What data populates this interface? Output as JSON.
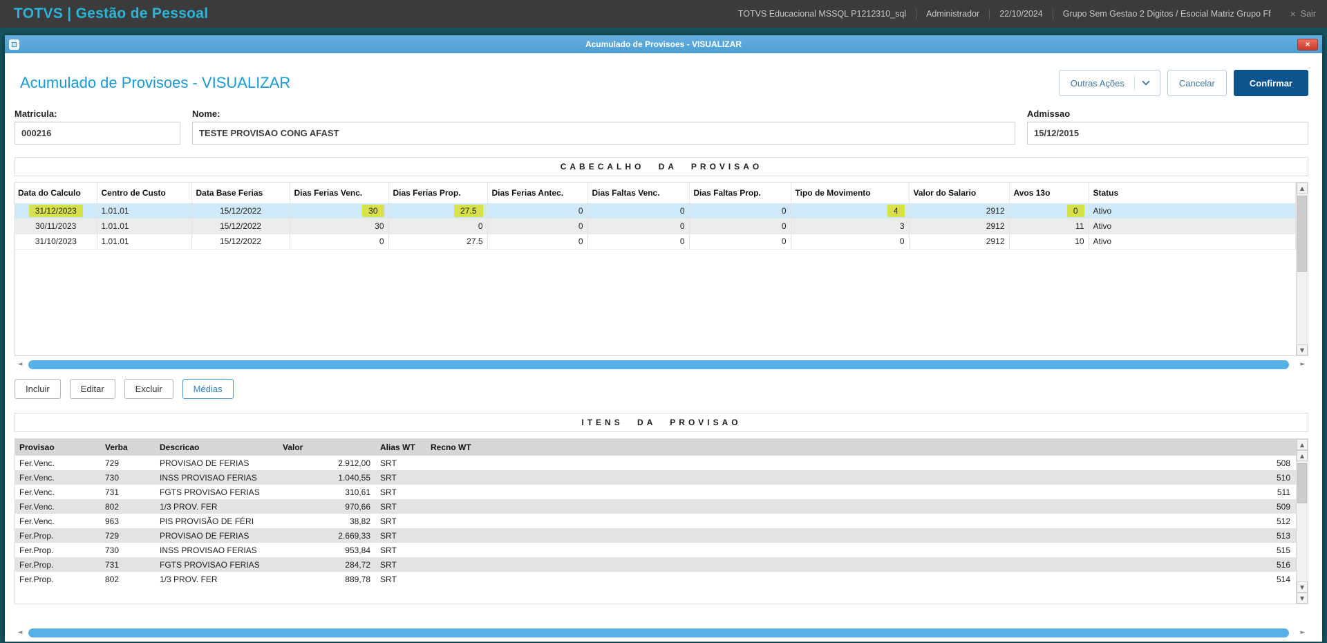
{
  "colors": {
    "brand_cyan": "#2bb5da",
    "titlebar_blue": "#55a6d8",
    "confirm_blue": "#0f538d",
    "selected_row_blue": "#cfe9f8",
    "highlight_yellow": "#d7e14a",
    "close_red": "#d0402f"
  },
  "icons": {
    "up": "▲",
    "down": "▼",
    "left": "◄",
    "right": "►",
    "close": "×",
    "logout_x": "×"
  },
  "topbar": {
    "brand": "TOTVS | Gestão de Pessoal",
    "environment": "TOTVS Educacional MSSQL P1212310_sql",
    "user": "Administrador",
    "date": "22/10/2024",
    "group": "Grupo Sem Gestao 2 Digitos / Esocial Matriz Grupo Ff",
    "logout_label": "Sair"
  },
  "modal": {
    "titlebar_text": "Acumulado de Provisoes - VISUALIZAR",
    "page_title": "Acumulado de Provisoes - VISUALIZAR",
    "actions": {
      "outras_acoes": "Outras Ações",
      "cancelar": "Cancelar",
      "confirmar": "Confirmar"
    }
  },
  "form": {
    "matricula_label": "Matricula:",
    "matricula_value": "000216",
    "nome_label": "Nome:",
    "nome_value": "TESTE PROVISAO CONG AFAST",
    "admissao_label": "Admissao",
    "admissao_value": "15/12/2015"
  },
  "header_section": {
    "title": "CABECALHO DA PROVISAO",
    "columns": [
      "Data do Calculo",
      "Centro de Custo",
      "Data Base Ferias",
      "Dias Ferias Venc.",
      "Dias Ferias Prop.",
      "Dias Ferias Antec.",
      "Dias Faltas Venc.",
      "Dias Faltas Prop.",
      "Tipo de Movimento",
      "Valor do Salario",
      "Avos 13o",
      "Status"
    ],
    "rows": [
      {
        "selected": true,
        "highlighted_cells": [
          0,
          3,
          4,
          8,
          10
        ],
        "cells": [
          "31/12/2023",
          "1.01.01",
          "15/12/2022",
          "30",
          "27.5",
          "0",
          "0",
          "0",
          "4",
          "2912",
          "0",
          "Ativo"
        ]
      },
      {
        "selected": false,
        "highlighted_cells": [],
        "cells": [
          "30/11/2023",
          "1.01.01",
          "15/12/2022",
          "30",
          "0",
          "0",
          "0",
          "0",
          "3",
          "2912",
          "11",
          "Ativo"
        ]
      },
      {
        "selected": false,
        "highlighted_cells": [],
        "cells": [
          "31/10/2023",
          "1.01.01",
          "15/12/2022",
          "0",
          "27.5",
          "0",
          "0",
          "0",
          "0",
          "2912",
          "10",
          "Ativo"
        ]
      }
    ]
  },
  "grid_buttons": [
    "Incluir",
    "Editar",
    "Excluir",
    "Médias"
  ],
  "items_section": {
    "title": "ITENS DA PROVISAO",
    "columns": [
      "Provisao",
      "Verba",
      "Descricao",
      "Valor",
      "Alias WT",
      "Recno WT"
    ],
    "rows": [
      [
        "Fer.Venc.",
        "729",
        "PROVISAO DE FERIAS",
        "2.912,00",
        "SRT",
        "508"
      ],
      [
        "Fer.Venc.",
        "730",
        "INSS PROVISAO FERIAS",
        "1.040,55",
        "SRT",
        "510"
      ],
      [
        "Fer.Venc.",
        "731",
        "FGTS PROVISAO FERIAS",
        "310,61",
        "SRT",
        "511"
      ],
      [
        "Fer.Venc.",
        "802",
        "1/3 PROV. FER",
        "970,66",
        "SRT",
        "509"
      ],
      [
        "Fer.Venc.",
        "963",
        "PIS PROVISÃO DE FÉRI",
        "38,82",
        "SRT",
        "512"
      ],
      [
        "Fer.Prop.",
        "729",
        "PROVISAO DE FERIAS",
        "2.669,33",
        "SRT",
        "513"
      ],
      [
        "Fer.Prop.",
        "730",
        "INSS PROVISAO FERIAS",
        "953,84",
        "SRT",
        "515"
      ],
      [
        "Fer.Prop.",
        "731",
        "FGTS PROVISAO FERIAS",
        "284,72",
        "SRT",
        "516"
      ],
      [
        "Fer.Prop.",
        "802",
        "1/3 PROV. FER",
        "889,78",
        "SRT",
        "514"
      ]
    ]
  }
}
